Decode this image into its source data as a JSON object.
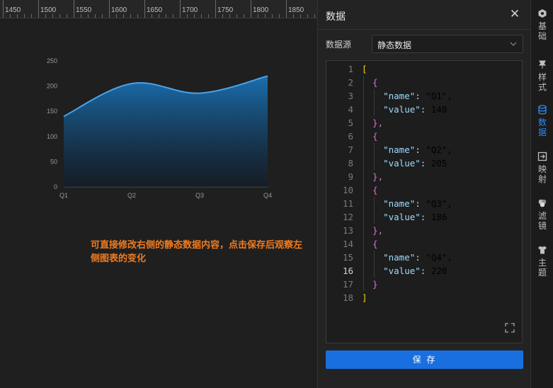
{
  "ruler": {
    "marks": [
      "1450",
      "1500",
      "1550",
      "1600",
      "1650",
      "1700",
      "1750",
      "1800",
      "1850"
    ]
  },
  "chart_data": {
    "type": "area",
    "categories": [
      "Q1",
      "Q2",
      "Q3",
      "Q4"
    ],
    "values": [
      140,
      205,
      186,
      220
    ],
    "ylim": [
      0,
      250
    ],
    "yticks": [
      "0",
      "50",
      "100",
      "150",
      "200",
      "250"
    ],
    "smooth": true,
    "grid": false,
    "colors": {
      "line": "#4aa3e8",
      "fill_top": "#1a6fb0",
      "fill_bottom": "#0f1c2a"
    }
  },
  "hint": "可直接修改右侧的静态数据内容，点击保存后观察左侧图表的变化",
  "panel": {
    "title": "数据",
    "close_icon": "✕",
    "source_label": "数据源",
    "source_value": "静态数据",
    "save_label": "保 存"
  },
  "editor": {
    "active_line": 16,
    "lines": [
      {
        "n": "1",
        "t": "["
      },
      {
        "n": "2",
        "t": "  {"
      },
      {
        "n": "3",
        "t": "    \"name\": \"Q1\","
      },
      {
        "n": "4",
        "t": "    \"value\": 140"
      },
      {
        "n": "5",
        "t": "  },"
      },
      {
        "n": "6",
        "t": "  {"
      },
      {
        "n": "7",
        "t": "    \"name\": \"Q2\","
      },
      {
        "n": "8",
        "t": "    \"value\": 205"
      },
      {
        "n": "9",
        "t": "  },"
      },
      {
        "n": "10",
        "t": "  {"
      },
      {
        "n": "11",
        "t": "    \"name\": \"Q3\","
      },
      {
        "n": "12",
        "t": "    \"value\": 186"
      },
      {
        "n": "13",
        "t": "  },"
      },
      {
        "n": "14",
        "t": "  {"
      },
      {
        "n": "15",
        "t": "    \"name\": \"Q4\","
      },
      {
        "n": "16",
        "t": "    \"value\": 220"
      },
      {
        "n": "17",
        "t": "  }"
      },
      {
        "n": "18",
        "t": "]"
      }
    ]
  },
  "rail": [
    {
      "label": "基础",
      "icon": "hexagon-icon",
      "active": false
    },
    {
      "label": "样式",
      "icon": "pin-icon",
      "active": false
    },
    {
      "label": "数据",
      "icon": "database-icon",
      "active": true
    },
    {
      "label": "映射",
      "icon": "mapping-icon",
      "active": false
    },
    {
      "label": "滤镜",
      "icon": "filter-icon",
      "active": false
    },
    {
      "label": "主题",
      "icon": "shirt-icon",
      "active": false
    }
  ]
}
